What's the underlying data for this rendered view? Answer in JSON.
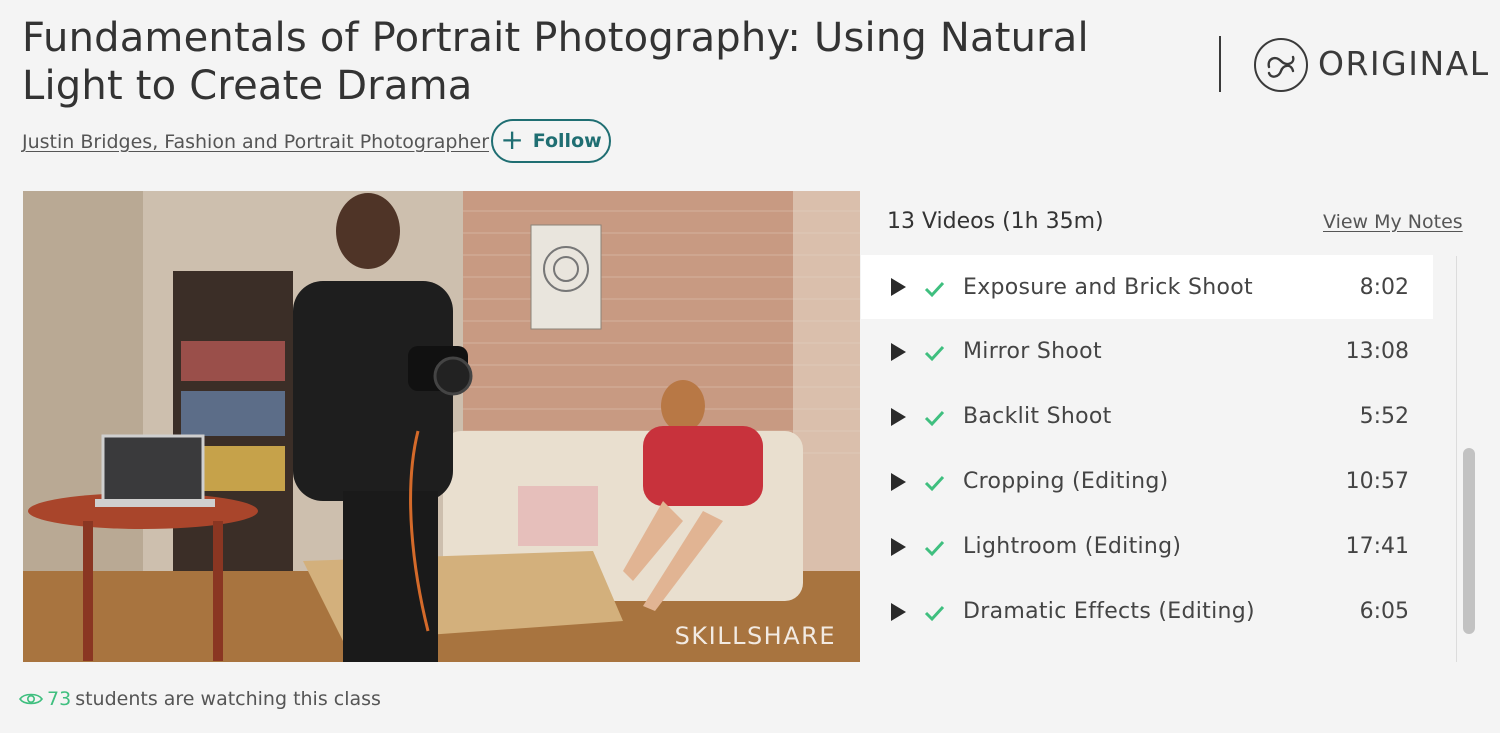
{
  "header": {
    "title": "Fundamentals of Portrait Photography: Using Natural Light to Create Drama",
    "author": "Justin Bridges, Fashion and Portrait Photographer",
    "follow_label": "Follow",
    "badge_text": "ORIGINAL"
  },
  "video": {
    "watermark": "SKILLSHARE"
  },
  "playlist": {
    "summary": "13 Videos (1h 35m)",
    "view_notes": "View My Notes",
    "items": [
      {
        "title": "Exposure and Brick Shoot",
        "duration": "8:02",
        "completed": true,
        "active": true
      },
      {
        "title": "Mirror Shoot",
        "duration": "13:08",
        "completed": true,
        "active": false
      },
      {
        "title": "Backlit Shoot",
        "duration": "5:52",
        "completed": true,
        "active": false
      },
      {
        "title": "Cropping (Editing)",
        "duration": "10:57",
        "completed": true,
        "active": false
      },
      {
        "title": "Lightroom (Editing)",
        "duration": "17:41",
        "completed": true,
        "active": false
      },
      {
        "title": "Dramatic Effects (Editing)",
        "duration": "6:05",
        "completed": true,
        "active": false
      }
    ]
  },
  "footer": {
    "watching_count": "73",
    "watching_text": "students are watching this class"
  },
  "colors": {
    "accent_teal": "#1f6e72",
    "check_green": "#3fbf7f",
    "background": "#f4f4f4"
  }
}
